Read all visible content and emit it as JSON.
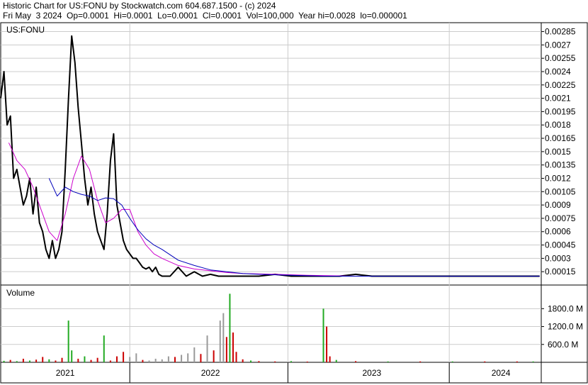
{
  "header": {
    "line1": "Historic Chart for US:FONU by Stockwatch.com 604.687.1500 - (c) 2024",
    "line2": "Fri May  3 2024  Op=0.0001  Hi=0.0001  Lo=0.0001  Cl=0.0001  Vol=100,000  Year hi=0.0028  lo=0.000001"
  },
  "colors": {
    "price": "#000000",
    "ma_short": "#cc00cc",
    "ma_long": "#0000bb",
    "volume_up": "#22aa22",
    "volume_down": "#cc0000",
    "volume_neutral": "#999999",
    "grid": "#cccccc"
  },
  "chart_data": [
    {
      "type": "line",
      "title": "US:FONU",
      "y_ticks": [
        "0.00285",
        "0.0027",
        "0.00255",
        "0.0024",
        "0.00225",
        "0.0021",
        "0.00195",
        "0.0018",
        "0.00165",
        "0.0015",
        "0.00135",
        "0.0012",
        "0.00105",
        "0.0009",
        "0.00075",
        "0.0006",
        "0.00045",
        "0.0003",
        "0.00015"
      ],
      "ylim": [
        0.0,
        0.00295
      ],
      "x_labels": [
        "2021",
        "2022",
        "2023",
        "2024"
      ],
      "xlim": [
        2021.0,
        2024.35
      ],
      "series": [
        {
          "key": "price",
          "x": [
            2021.0,
            2021.02,
            2021.04,
            2021.06,
            2021.08,
            2021.1,
            2021.12,
            2021.14,
            2021.16,
            2021.18,
            2021.2,
            2021.22,
            2021.24,
            2021.26,
            2021.28,
            2021.3,
            2021.32,
            2021.34,
            2021.36,
            2021.38,
            2021.4,
            2021.42,
            2021.44,
            2021.46,
            2021.48,
            2021.5,
            2021.52,
            2021.54,
            2021.56,
            2021.58,
            2021.6,
            2021.62,
            2021.64,
            2021.66,
            2021.68,
            2021.7,
            2021.72,
            2021.74,
            2021.76,
            2021.78,
            2021.8,
            2021.82,
            2021.84,
            2021.86,
            2021.88,
            2021.9,
            2021.92,
            2021.94,
            2021.96,
            2021.98,
            2022.0,
            2022.05,
            2022.1,
            2022.15,
            2022.2,
            2022.25,
            2022.3,
            2022.35,
            2022.4,
            2022.45,
            2022.5,
            2022.55,
            2022.6,
            2022.7,
            2022.8,
            2022.9,
            2023.0,
            2023.1,
            2023.2,
            2023.3,
            2023.4,
            2023.5,
            2023.6,
            2023.7,
            2023.8,
            2023.9,
            2024.0,
            2024.1,
            2024.2,
            2024.34
          ],
          "y": [
            0.0021,
            0.0024,
            0.0018,
            0.0019,
            0.0012,
            0.0013,
            0.0011,
            0.0009,
            0.001,
            0.0012,
            0.0008,
            0.0011,
            0.0007,
            0.0006,
            0.0004,
            0.0003,
            0.0005,
            0.0003,
            0.0004,
            0.0006,
            0.0013,
            0.0021,
            0.0028,
            0.0025,
            0.002,
            0.0016,
            0.0012,
            0.0009,
            0.0011,
            0.0008,
            0.0006,
            0.0005,
            0.0004,
            0.0008,
            0.0014,
            0.0017,
            0.0009,
            0.0007,
            0.0005,
            0.0004,
            0.00035,
            0.0003,
            0.0003,
            0.00025,
            0.0002,
            0.00018,
            0.0002,
            0.00015,
            0.0002,
            0.00012,
            0.0001,
            0.0001,
            0.0002,
            0.0001,
            0.00015,
            0.0001,
            0.00012,
            0.0001,
            0.0001,
            0.0001,
            0.0001,
            0.0001,
            0.0001,
            0.00012,
            0.0001,
            0.0001,
            0.0001,
            0.0001,
            0.00012,
            0.0001,
            0.0001,
            0.0001,
            0.0001,
            0.0001,
            0.0001,
            0.0001,
            0.0001,
            0.0001,
            0.0001,
            0.0001
          ]
        },
        {
          "key": "ma_short",
          "x": [
            2021.05,
            2021.1,
            2021.15,
            2021.2,
            2021.25,
            2021.3,
            2021.35,
            2021.4,
            2021.45,
            2021.5,
            2021.55,
            2021.6,
            2021.65,
            2021.7,
            2021.75,
            2021.8,
            2021.85,
            2021.9,
            2021.95,
            2022.0,
            2022.1,
            2022.2,
            2022.3,
            2022.4,
            2022.5,
            2022.7,
            2022.9,
            2023.2,
            2023.6,
            2024.0,
            2024.34
          ],
          "y": [
            0.0016,
            0.0014,
            0.0013,
            0.0011,
            0.00085,
            0.0006,
            0.0005,
            0.0008,
            0.0012,
            0.00145,
            0.0013,
            0.00095,
            0.0007,
            0.00075,
            0.00085,
            0.00085,
            0.0006,
            0.00045,
            0.00035,
            0.0003,
            0.00022,
            0.00018,
            0.00016,
            0.00014,
            0.00013,
            0.00012,
            0.00011,
            0.0001,
            0.0001,
            0.0001,
            0.0001
          ]
        },
        {
          "key": "ma_long",
          "x": [
            2021.3,
            2021.35,
            2021.4,
            2021.45,
            2021.5,
            2021.55,
            2021.6,
            2021.65,
            2021.7,
            2021.75,
            2021.8,
            2021.85,
            2021.9,
            2021.95,
            2022.0,
            2022.1,
            2022.2,
            2022.3,
            2022.4,
            2022.5,
            2022.6,
            2022.8,
            2023.0,
            2023.5,
            2024.0,
            2024.34
          ],
          "y": [
            0.0012,
            0.001,
            0.0011,
            0.00105,
            0.00102,
            0.001,
            0.00095,
            0.00098,
            0.00097,
            0.0009,
            0.00075,
            0.00062,
            0.00052,
            0.00045,
            0.0004,
            0.00028,
            0.00022,
            0.00017,
            0.00015,
            0.00013,
            0.00012,
            0.00011,
            0.0001,
            0.0001,
            0.0001,
            0.0001
          ]
        }
      ]
    },
    {
      "type": "bar",
      "title": "Volume",
      "y_ticks": [
        "1800.0 M",
        "1200.0 M",
        "600.0 M"
      ],
      "ylim": [
        0,
        2450
      ],
      "x": [
        2021.02,
        2021.06,
        2021.1,
        2021.14,
        2021.18,
        2021.22,
        2021.26,
        2021.3,
        2021.34,
        2021.38,
        2021.42,
        2021.44,
        2021.48,
        2021.52,
        2021.56,
        2021.6,
        2021.64,
        2021.68,
        2021.72,
        2021.76,
        2021.8,
        2021.84,
        2021.88,
        2021.92,
        2021.96,
        2022.0,
        2022.04,
        2022.08,
        2022.12,
        2022.16,
        2022.2,
        2022.24,
        2022.28,
        2022.32,
        2022.36,
        2022.38,
        2022.4,
        2022.42,
        2022.44,
        2022.46,
        2022.5,
        2022.55,
        2022.6,
        2022.7,
        2022.8,
        2022.9,
        2023.0,
        2023.02,
        2023.04,
        2023.08,
        2023.2,
        2023.4,
        2023.6,
        2023.8,
        2024.0,
        2024.2,
        2024.3
      ],
      "values": [
        50,
        80,
        40,
        120,
        60,
        90,
        180,
        100,
        60,
        150,
        1400,
        400,
        120,
        200,
        80,
        150,
        900,
        60,
        200,
        350,
        180,
        300,
        80,
        60,
        120,
        100,
        200,
        180,
        250,
        300,
        500,
        280,
        900,
        400,
        1400,
        1650,
        850,
        2300,
        1000,
        350,
        100,
        60,
        40,
        30,
        40,
        25,
        1800,
        1200,
        200,
        80,
        40,
        30,
        30,
        30,
        30,
        30,
        30
      ],
      "colors": [
        "up",
        "down",
        "up",
        "down",
        "up",
        "down",
        "down",
        "up",
        "down",
        "down",
        "up",
        "up",
        "down",
        "up",
        "down",
        "down",
        "up",
        "down",
        "down",
        "down",
        "neutral",
        "neutral",
        "down",
        "neutral",
        "neutral",
        "neutral",
        "neutral",
        "down",
        "neutral",
        "neutral",
        "neutral",
        "down",
        "neutral",
        "down",
        "neutral",
        "neutral",
        "down",
        "up",
        "down",
        "down",
        "down",
        "up",
        "down",
        "down",
        "up",
        "down",
        "up",
        "down",
        "down",
        "up",
        "down",
        "up",
        "down",
        "up",
        "down",
        "down",
        "up"
      ]
    }
  ]
}
